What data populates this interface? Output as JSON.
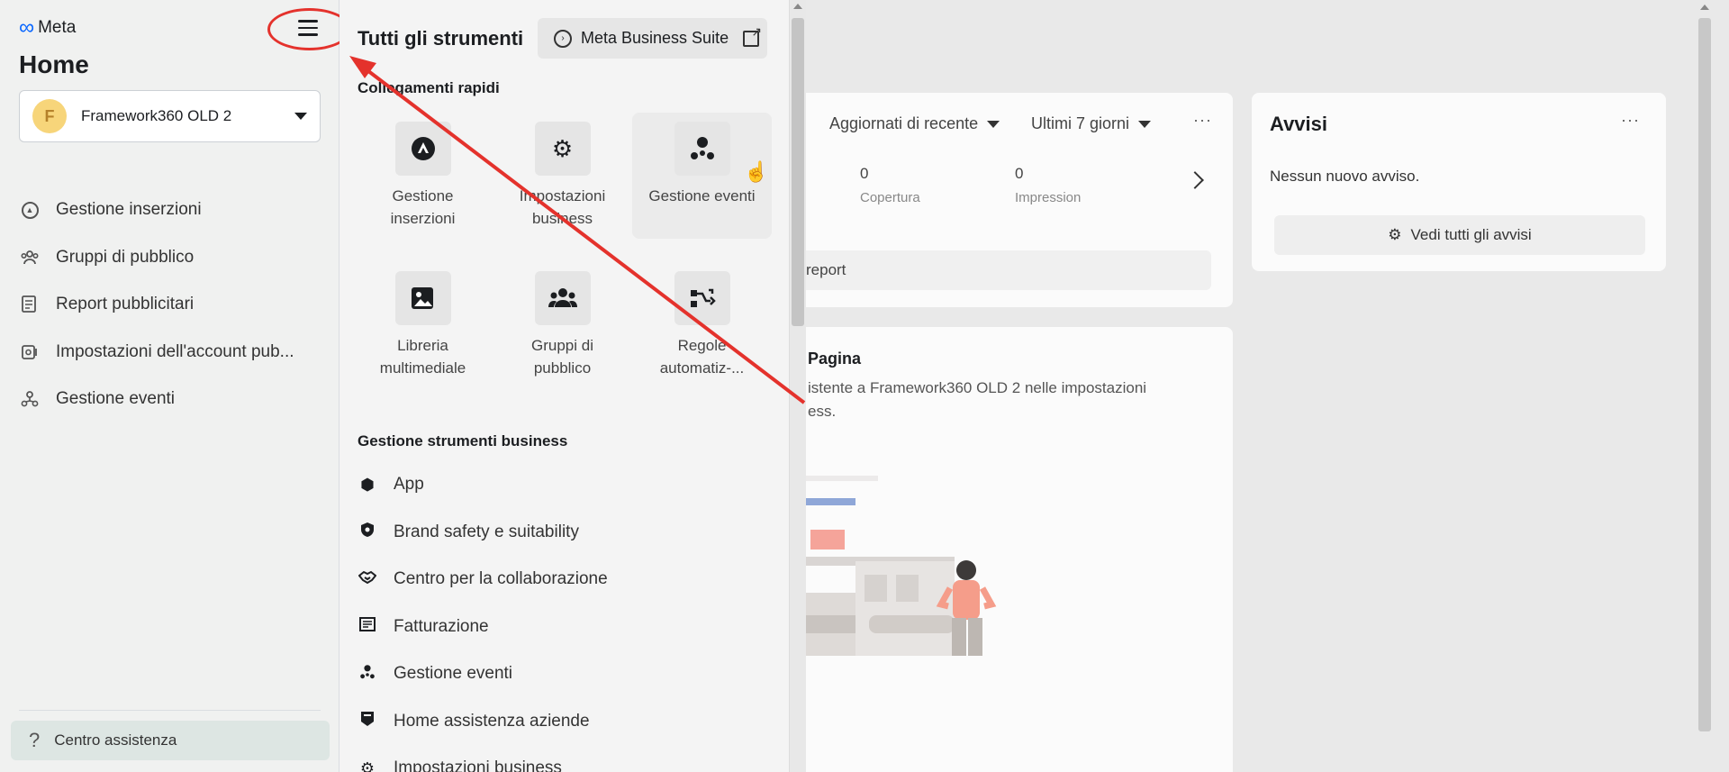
{
  "sidebar": {
    "brand": "Meta",
    "title": "Home",
    "account": {
      "initial": "F",
      "name": "Framework360 OLD 2"
    },
    "items": [
      {
        "label": "Gestione inserzioni",
        "icon": "ads-manager-icon"
      },
      {
        "label": "Gruppi di pubblico",
        "icon": "audience-icon"
      },
      {
        "label": "Report pubblicitari",
        "icon": "report-icon"
      },
      {
        "label": "Impostazioni dell'account pub...",
        "icon": "account-settings-icon"
      },
      {
        "label": "Gestione eventi",
        "icon": "events-icon"
      }
    ],
    "help": "Centro assistenza"
  },
  "tools": {
    "title": "Tutti gli strumenti",
    "business_suite": "Meta Business Suite",
    "quick_links_label": "Collegamenti rapidi",
    "quick_links": [
      {
        "label": "Gestione inserzioni",
        "icon": "ads-manager-icon"
      },
      {
        "label": "Impostazioni business",
        "icon": "gear-icon"
      },
      {
        "label": "Gestione eventi",
        "icon": "events-manager-icon"
      },
      {
        "label": "Libreria multimediale",
        "icon": "media-library-icon"
      },
      {
        "label": "Gruppi di pubblico",
        "icon": "audience-icon"
      },
      {
        "label": "Regole automatiz-...",
        "icon": "automated-rules-icon"
      }
    ],
    "business_tools_label": "Gestione strumenti business",
    "business_tools": [
      {
        "label": "App",
        "icon": "cube-icon"
      },
      {
        "label": "Brand safety e suitability",
        "icon": "shield-icon"
      },
      {
        "label": "Centro per la collaborazione",
        "icon": "handshake-icon"
      },
      {
        "label": "Fatturazione",
        "icon": "billing-icon"
      },
      {
        "label": "Gestione eventi",
        "icon": "events-manager-icon"
      },
      {
        "label": "Home assistenza aziende",
        "icon": "support-icon"
      },
      {
        "label": "Impostazioni business",
        "icon": "gear-icon"
      }
    ]
  },
  "dashboard": {
    "filter_sort": "Aggiornati di recente",
    "filter_range": "Ultimi 7 giorni",
    "more": "···",
    "metrics": [
      {
        "value": "0",
        "label": "Copertura"
      },
      {
        "value": "0",
        "label": "Impression"
      }
    ],
    "report_button": "report",
    "page_card_title": "Pagina",
    "page_card_text_1": "istente a Framework360 OLD 2 nelle impostazioni",
    "page_card_text_2": "ess."
  },
  "alerts": {
    "title": "Avvisi",
    "more": "···",
    "empty": "Nessun nuovo avviso.",
    "button": "Vedi tutti gli avvisi"
  },
  "colors": {
    "annotation_red": "#e4322c",
    "meta_blue": "#0866ff"
  }
}
